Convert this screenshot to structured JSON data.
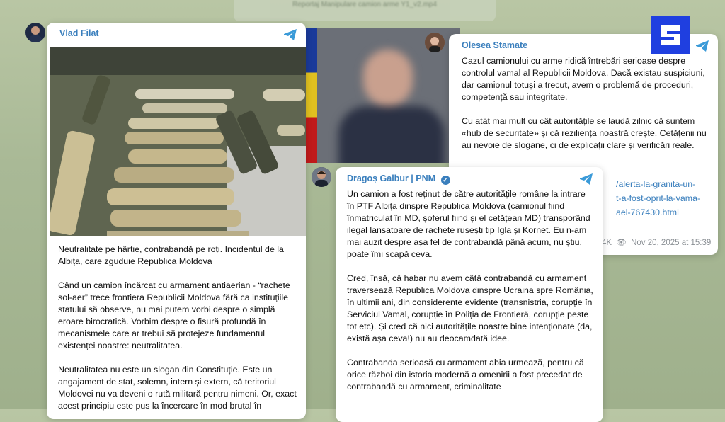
{
  "window_title": "Reportaj Manipulare camion arme Y1_v2.mp4",
  "logo_text": "S",
  "vlad": {
    "author": "Vlad Filat",
    "paragraphs": [
      "Neutralitate pe hârtie, contrabandă pe roți. Incidentul de la Albița, care zguduie Republica Moldova",
      "Când un camion încărcat cu armament antiaerian - “rachete sol-aer” trece frontiera Republicii Moldova fără ca instituțiile statului să observe, nu mai putem vorbi despre o simplă eroare birocratică. Vorbim despre o fisură profundă în mecanismele care ar trebui să protejeze fundamentul existenței noastre: neutralitatea.",
      "Neutralitatea nu este un slogan din Constituție. Este un angajament de stat, solemn, intern și extern, că teritoriul Moldovei nu va deveni o rută militară pentru nimeni. Or, exact acest principiu este pus la încercare în mod brutal în"
    ]
  },
  "olesea": {
    "author": "Olesea Stamate",
    "paragraphs": [
      "Cazul camionului cu arme ridică întrebări serioase despre controlul vamal al Republicii Moldova. Dacă existau suspiciuni, dar camionul totuși a trecut, avem o problemă de proceduri, competență sau integritate.",
      "Cu atât mai mult cu cât autoritățile se laudă zilnic că suntem «hub de securitate» și că reziliența noastră crește. Cetățenii nu au nevoie de slogane, ci de explicații clare și verificări reale."
    ],
    "link_lines": [
      "/alerta-la-granita-un-",
      "t-a-fost-oprit-la-vama-",
      "ael-767430.html"
    ],
    "views": "4K",
    "date": "Nov 20, 2025 at 15:39"
  },
  "dragos": {
    "author": "Dragoș Galbur | PNM",
    "paragraphs": [
      "Un camion a fost reținut de către autoritățile române la intrare în PTF Albița dinspre Republica Moldova (camionul fiind înmatriculat în MD, șoferul fiind și el cetățean MD) transporând ilegal lansatoare de rachete rusești tip Igla și Kornet. Eu n-am mai auzit despre așa fel de contrabandă până acum, nu știu, poate îmi scapă ceva.",
      "Cred, însă, că habar nu avem câtă contrabandă cu armament traversează Republica Moldova dinspre Ucraina spre România, în ultimii ani, din considerente evidente (transnistria, corupție în Serviciul Vamal, corupție în Poliția de Frontieră, corupție peste tot etc). Și cred că nici autoritățile noastre bine intenționate (da, există așa ceva!) nu au deocamdată idee.",
      "Contrabanda serioasă cu armament abia urmează, pentru că orice război din istoria modernă a omenirii a fost precedat de contrabandă cu armament, criminalitate"
    ]
  },
  "colors": {
    "accent": "#3a7fbd",
    "logo": "#1f3fe0",
    "verified": "#3a7fbd"
  }
}
